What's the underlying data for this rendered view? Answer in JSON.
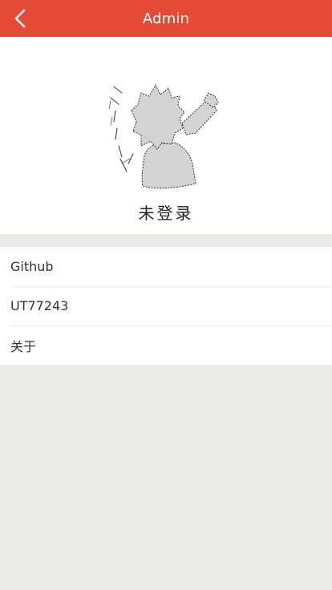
{
  "header": {
    "title": "Admin",
    "back_icon": "chevron-left-icon",
    "background": "#e44a35"
  },
  "profile": {
    "avatar": "anime-silhouette-avatar",
    "status_text": "未登录"
  },
  "menu": {
    "items": [
      {
        "label": "Github"
      },
      {
        "label": "UT77243"
      },
      {
        "label": "关于"
      }
    ]
  }
}
